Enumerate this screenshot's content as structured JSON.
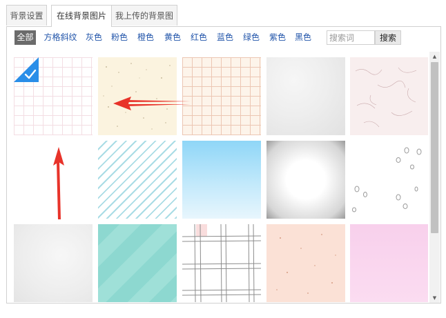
{
  "tabs": [
    {
      "label": "背景设置",
      "active": false
    },
    {
      "label": "在线背景图片",
      "active": true
    },
    {
      "label": "我上传的背景图",
      "active": false
    }
  ],
  "filters": {
    "items": [
      "全部",
      "方格斜纹",
      "灰色",
      "粉色",
      "橙色",
      "黄色",
      "红色",
      "蓝色",
      "绿色",
      "紫色",
      "黑色"
    ],
    "active_index": 0
  },
  "search": {
    "placeholder": "搜索词",
    "value": "",
    "button_label": "搜索"
  },
  "grid": {
    "selected_index": 0,
    "tiles": [
      {
        "pattern": "pink-grid-paper"
      },
      {
        "pattern": "speckled-cream-paper"
      },
      {
        "pattern": "peach-grid-paper"
      },
      {
        "pattern": "crumpled-grey-paper"
      },
      {
        "pattern": "pink-fiber-paper"
      },
      {
        "pattern": "plain-white"
      },
      {
        "pattern": "blue-diagonal-stripes"
      },
      {
        "pattern": "blue-gradient"
      },
      {
        "pattern": "grey-vignette-paper"
      },
      {
        "pattern": "water-drops"
      },
      {
        "pattern": "crumpled-light-paper"
      },
      {
        "pattern": "teal-diagonal"
      },
      {
        "pattern": "sketch-plaid"
      },
      {
        "pattern": "speckled-peach-paper"
      },
      {
        "pattern": "pink-solid"
      }
    ]
  },
  "annotations": [
    {
      "type": "red-arrow",
      "points_to": "pink-grid-paper"
    },
    {
      "type": "red-arrow",
      "points_to": "pink-grid-paper"
    }
  ],
  "icons": {
    "check": "checkmark-icon",
    "scroll_up": "triangle-up-icon",
    "scroll_down": "triangle-down-icon"
  },
  "colors": {
    "accent_blue": "#2a8ee8",
    "link_blue": "#2255aa",
    "active_chip": "#6b6b6b",
    "arrow_red": "#e8332a"
  }
}
